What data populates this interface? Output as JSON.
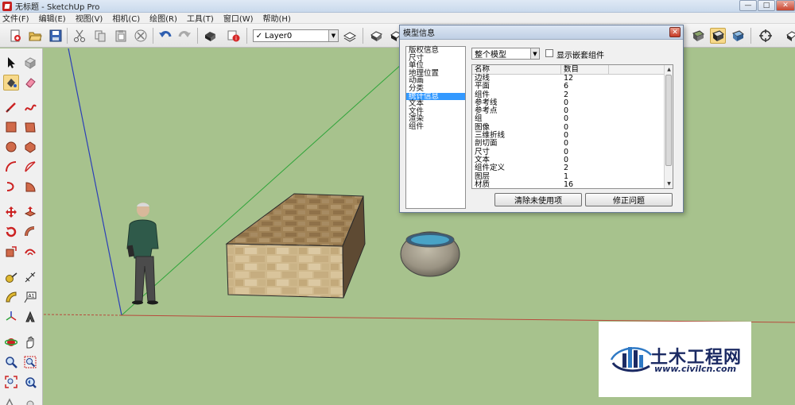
{
  "window": {
    "title": "无标题 - SketchUp Pro",
    "controls": {
      "minimize": "—",
      "maximize": "□",
      "close": "✕"
    }
  },
  "menubar": {
    "items": [
      "文件(F)",
      "编辑(E)",
      "视图(V)",
      "相机(C)",
      "绘图(R)",
      "工具(T)",
      "窗口(W)",
      "帮助(H)"
    ]
  },
  "toolbar": {
    "layer": {
      "check": "✓",
      "value": "Layer0",
      "arrow": "▼"
    },
    "icons": [
      "new-file-icon",
      "open-folder-icon",
      "save-icon",
      "cut-icon",
      "copy-icon",
      "paste-icon",
      "erase-icon",
      "undo-icon",
      "redo-icon",
      "print-icon",
      "model-info-icon",
      "layer-manager-icon",
      "component-icon",
      "make-component-icon"
    ]
  },
  "dialog": {
    "title": "模型信息",
    "close": "✕",
    "nav": {
      "items": [
        "版权信息",
        "尺寸",
        "单位",
        "地理位置",
        "动画",
        "分类",
        "统计信息",
        "文本",
        "文件",
        "渲染",
        "组件"
      ],
      "selected_index": 6
    },
    "scope": {
      "value": "整个模型",
      "arrow": "▼"
    },
    "nested": {
      "label": "显示嵌套组件",
      "checked": false
    },
    "table": {
      "headers": [
        "名称",
        "数目"
      ],
      "rows": [
        {
          "name": "边线",
          "count": "12"
        },
        {
          "name": "平面",
          "count": "6"
        },
        {
          "name": "组件",
          "count": "2"
        },
        {
          "name": "参考线",
          "count": "0"
        },
        {
          "name": "参考点",
          "count": "0"
        },
        {
          "name": "组",
          "count": "0"
        },
        {
          "name": "图像",
          "count": "0"
        },
        {
          "name": "三维折线",
          "count": "0"
        },
        {
          "name": "剖切面",
          "count": "0"
        },
        {
          "name": "尺寸",
          "count": "0"
        },
        {
          "name": "文本",
          "count": "0"
        },
        {
          "name": "组件定义",
          "count": "2"
        },
        {
          "name": "图层",
          "count": "1"
        },
        {
          "name": "材质",
          "count": "16"
        }
      ],
      "scroll_up": "▲",
      "scroll_down": "▼"
    },
    "buttons": {
      "purge": "清除未使用项",
      "fix": "修正问题"
    }
  },
  "watermark": {
    "brand": "土木工程网",
    "url": "www.civilcn.com"
  },
  "colors": {
    "ground": "#a7c28d",
    "selection": "#3399ff",
    "axis_red": "#b84a3c",
    "axis_green": "#2fa43a",
    "axis_blue": "#2b3fb8",
    "watermark_text": "#1b2a63"
  }
}
